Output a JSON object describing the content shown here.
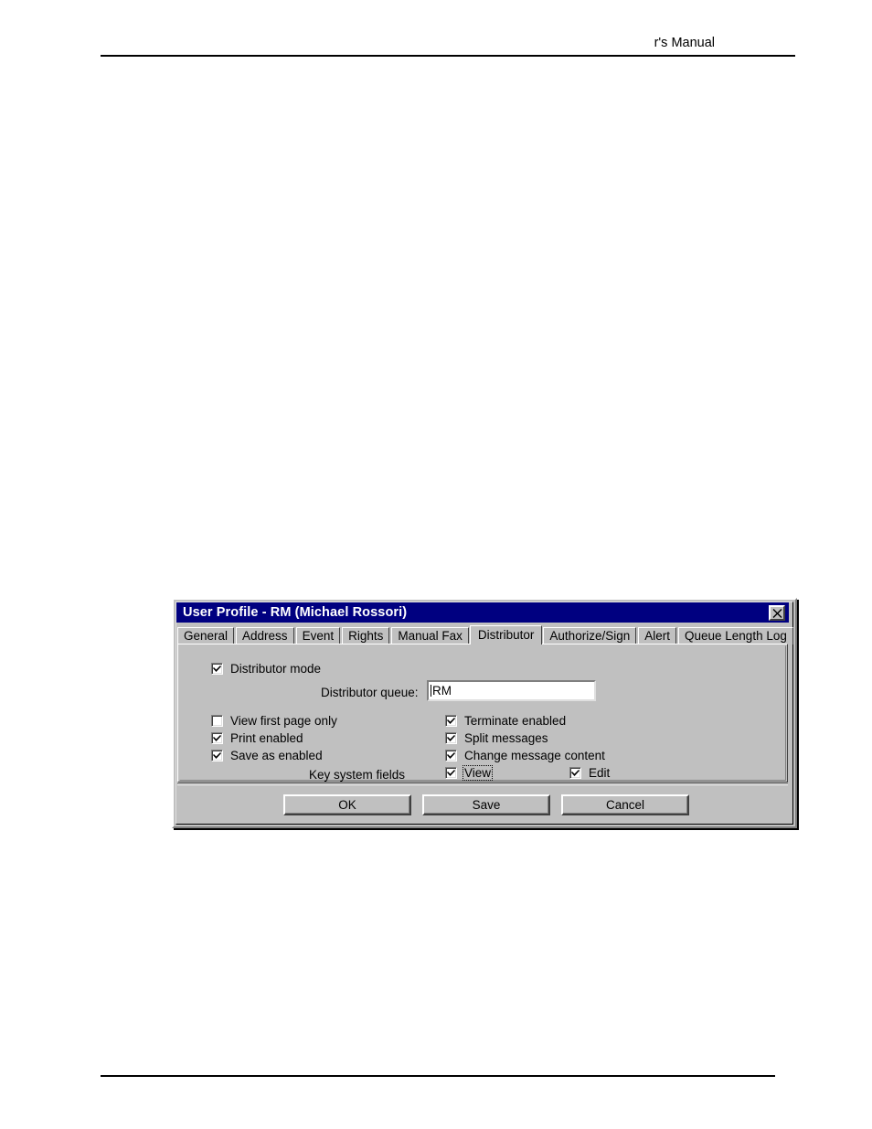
{
  "page": {
    "header_text": "r's Manual"
  },
  "dialog": {
    "title": "User Profile - RM (Michael Rossori)",
    "close_icon": "close-icon",
    "titlebar_color": "#000080",
    "face_color": "#c0c0c0",
    "tabs": [
      {
        "label": "General",
        "active": false
      },
      {
        "label": "Address",
        "active": false
      },
      {
        "label": "Event",
        "active": false
      },
      {
        "label": "Rights",
        "active": false
      },
      {
        "label": "Manual Fax",
        "active": false
      },
      {
        "label": "Distributor",
        "active": true
      },
      {
        "label": "Authorize/Sign",
        "active": false
      },
      {
        "label": "Alert",
        "active": false
      },
      {
        "label": "Queue Length Log",
        "active": false
      }
    ],
    "distributor_tab": {
      "distributor_mode": {
        "label": "Distributor mode",
        "checked": true
      },
      "queue_field": {
        "label": "Distributor queue:",
        "value": "RM"
      },
      "left_options": [
        {
          "label": "View first page only",
          "checked": false
        },
        {
          "label": "Print enabled",
          "checked": true
        },
        {
          "label": "Save as enabled",
          "checked": true
        }
      ],
      "right_options": [
        {
          "label": "Terminate enabled",
          "checked": true
        },
        {
          "label": "Split messages",
          "checked": true
        },
        {
          "label": "Change message content",
          "checked": true
        }
      ],
      "key_system_fields": {
        "label": "Key system fields",
        "view": {
          "label": "View",
          "checked": true,
          "focused": true
        },
        "edit": {
          "label": "Edit",
          "checked": true,
          "focused": false
        }
      }
    },
    "buttons": {
      "ok": "OK",
      "save": "Save",
      "cancel": "Cancel"
    }
  }
}
